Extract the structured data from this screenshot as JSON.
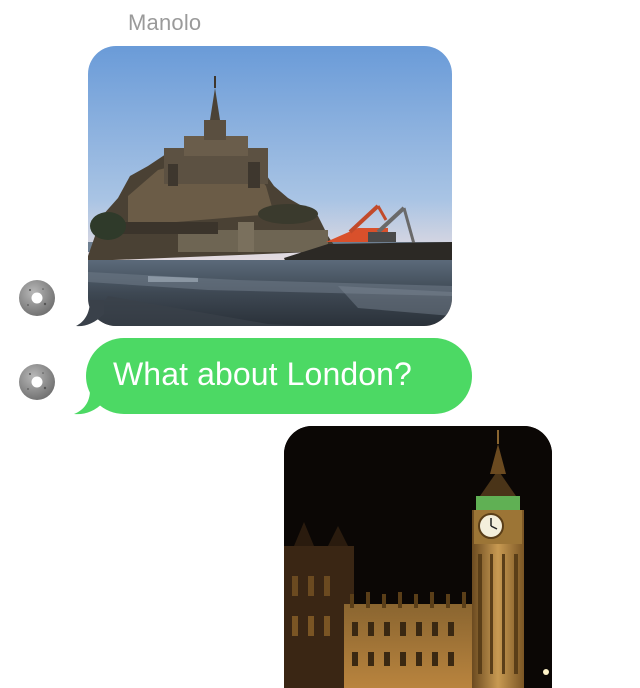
{
  "thread": {
    "sender_name": "Manolo",
    "colors": {
      "received_bubble": "#4cd964",
      "received_text": "#ffffff",
      "sender_name_text": "#9a9a9a"
    },
    "messages": [
      {
        "kind": "photo",
        "direction": "received",
        "subject": "Mont-Saint-Michel at dusk with excavator"
      },
      {
        "kind": "text",
        "direction": "received",
        "text": "What about London?"
      },
      {
        "kind": "photo",
        "direction": "sent",
        "subject": "Big Ben clock tower at night"
      }
    ],
    "avatar_icon": "stone-ring-avatar-icon"
  }
}
